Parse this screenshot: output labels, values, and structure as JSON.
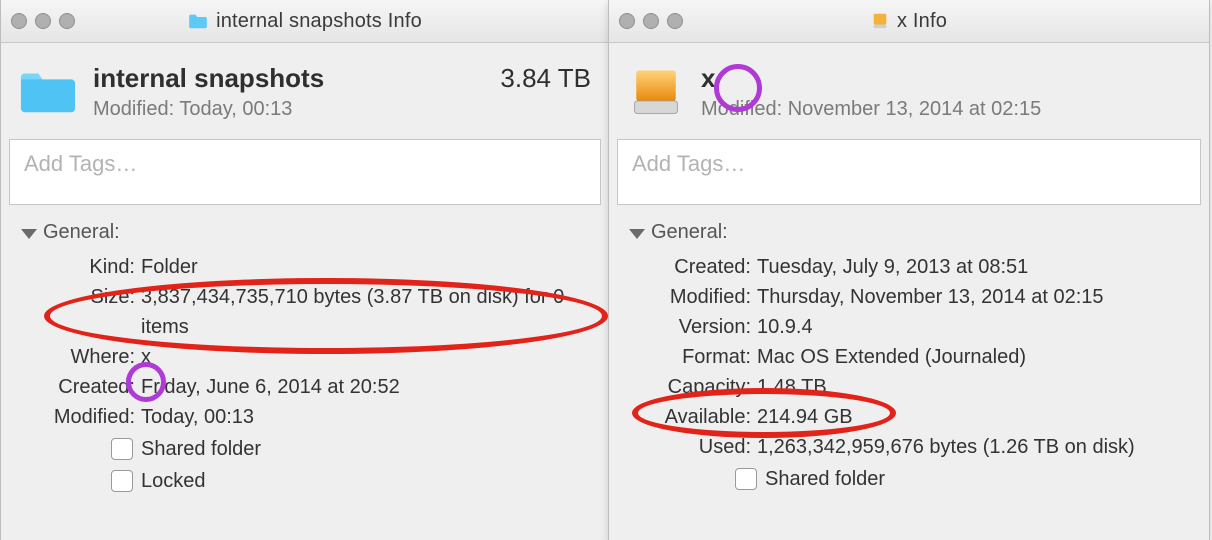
{
  "left": {
    "title": "internal snapshots Info",
    "header_name": "internal snapshots",
    "header_size": "3.84 TB",
    "header_modified": "Modified: Today, 00:13",
    "tags_placeholder": "Add Tags…",
    "section_general": "General:",
    "kind_label": "Kind:",
    "kind_value": "Folder",
    "size_label": "Size:",
    "size_value": "3,837,434,735,710 bytes (3.87 TB on disk) for 0 items",
    "where_label": "Where:",
    "where_value": "x",
    "created_label": "Created:",
    "created_value": "Friday, June 6, 2014 at 20:52",
    "modified_label": "Modified:",
    "modified_value": "Today, 00:13",
    "shared_label": "Shared folder",
    "locked_label": "Locked"
  },
  "right": {
    "title": "x Info",
    "header_name": "x",
    "header_modified": "Modified: November 13, 2014 at 02:15",
    "tags_placeholder": "Add Tags…",
    "section_general": "General:",
    "created_label": "Created:",
    "created_value": "Tuesday, July 9, 2013 at 08:51",
    "modified_label": "Modified:",
    "modified_value": "Thursday, November 13, 2014 at 02:15",
    "version_label": "Version:",
    "version_value": "10.9.4",
    "format_label": "Format:",
    "format_value": "Mac OS Extended (Journaled)",
    "capacity_label": "Capacity:",
    "capacity_value": "1.48 TB",
    "available_label": "Available:",
    "available_value": "214.94 GB",
    "used_label": "Used:",
    "used_value": "1,263,342,959,676 bytes (1.26 TB on disk)",
    "shared_label": "Shared folder"
  }
}
